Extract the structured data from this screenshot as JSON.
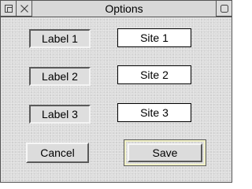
{
  "window": {
    "title": "Options"
  },
  "titlebar": {
    "back_icon": "back-icon",
    "close_icon": "close-icon",
    "toggle_icon": "toggle-size-icon"
  },
  "rows": [
    {
      "label": "Label 1",
      "site": "Site 1"
    },
    {
      "label": "Label 2",
      "site": "Site 2"
    },
    {
      "label": "Label 3",
      "site": "Site 3"
    }
  ],
  "buttons": {
    "cancel": "Cancel",
    "save": "Save"
  },
  "colors": {
    "background": "#dcdcdc",
    "default_button_highlight": "#f2f2c8",
    "field_background": "#ffffff"
  }
}
